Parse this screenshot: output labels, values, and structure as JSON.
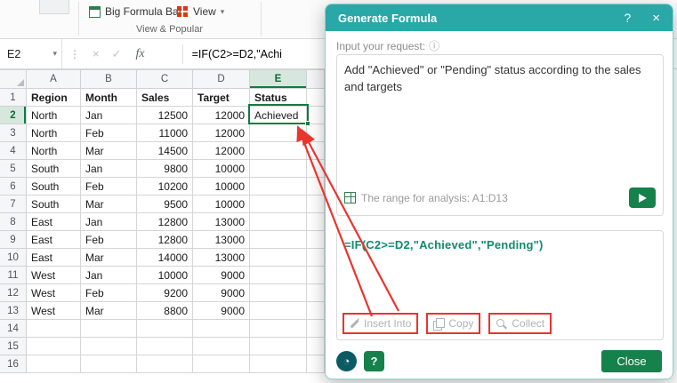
{
  "ribbon": {
    "items": [
      {
        "label": "Big Formula Bar"
      },
      {
        "label": "View"
      }
    ],
    "group_label": "View & Popular"
  },
  "formula_bar": {
    "name_box": "E2",
    "fx_label": "fx",
    "formula": "=IF(C2>=D2,\"Achi"
  },
  "grid": {
    "col_letters": [
      "A",
      "B",
      "C",
      "D",
      "E"
    ],
    "header_row": [
      "Region",
      "Month",
      "Sales",
      "Target",
      "Status"
    ],
    "data_rows": [
      [
        "North",
        "Jan",
        "12500",
        "12000",
        "Achieved"
      ],
      [
        "North",
        "Feb",
        "11000",
        "12000",
        ""
      ],
      [
        "North",
        "Mar",
        "14500",
        "12000",
        ""
      ],
      [
        "South",
        "Jan",
        "9800",
        "10000",
        ""
      ],
      [
        "South",
        "Feb",
        "10200",
        "10000",
        ""
      ],
      [
        "South",
        "Mar",
        "9500",
        "10000",
        ""
      ],
      [
        "East",
        "Jan",
        "12800",
        "13000",
        ""
      ],
      [
        "East",
        "Feb",
        "12800",
        "13000",
        ""
      ],
      [
        "East",
        "Mar",
        "14000",
        "13000",
        ""
      ],
      [
        "West",
        "Jan",
        "10000",
        "9000",
        ""
      ],
      [
        "West",
        "Feb",
        "9200",
        "9000",
        ""
      ],
      [
        "West",
        "Mar",
        "8800",
        "9000",
        ""
      ],
      [
        "",
        "",
        "",
        "",
        ""
      ],
      [
        "",
        "",
        "",
        "",
        ""
      ],
      [
        "",
        "",
        "",
        "",
        ""
      ]
    ],
    "selected_cell": "E2",
    "selected_col": "E",
    "selected_row": 2
  },
  "dialog": {
    "title": "Generate Formula",
    "help_label": "?",
    "close_x": "×",
    "input_label": "Input your request:",
    "request": "Add \"Achieved\" or \"Pending\" status according to the sales and targets",
    "range_info": "The range for analysis: A1:D13",
    "result_formula": "=IF(C2>=D2,\"Achieved\",\"Pending\")",
    "insert_label": "Insert Into",
    "copy_label": "Copy",
    "collect_label": "Collect",
    "close_label": "Close"
  },
  "icons": {
    "info": "ⓘ",
    "history": "◔",
    "name_chevron": "▾",
    "view_chevron": "▾",
    "cancel": "×",
    "enter": "✓",
    "dots": "⋮"
  },
  "colors": {
    "accent_green": "#107C41",
    "dialog_teal": "#2AA7A7",
    "button_green": "#15814B",
    "annotation_red": "#E8352E",
    "formula_green": "#0E8C6E"
  }
}
